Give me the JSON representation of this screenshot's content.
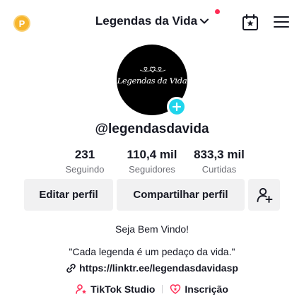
{
  "header": {
    "coin_letter": "P",
    "title": "Legendas da Vida"
  },
  "avatar": {
    "text": "Legendas da Vida"
  },
  "profile": {
    "username": "@legendasdavida"
  },
  "stats": [
    {
      "value": "231",
      "label": "Seguindo"
    },
    {
      "value": "110,4 mil",
      "label": "Seguidores"
    },
    {
      "value": "833,3 mil",
      "label": "Curtidas"
    }
  ],
  "actions": {
    "edit_label": "Editar perfil",
    "share_label": "Compartilhar perfil"
  },
  "bio": {
    "welcome": "Seja Bem Vindo!",
    "quote": "\"Cada legenda é um pedaço da vida.\"",
    "link": "https://linktr.ee/legendasdavidasp"
  },
  "extras": {
    "studio_label": "TikTok Studio",
    "subscription_label": "Inscrição"
  },
  "colors": {
    "accent_red": "#FE2C55",
    "accent_cyan": "#20D5EC",
    "coin_gold": "#F7B52C",
    "button_bg": "#F1F1F2"
  },
  "icons": [
    "coin-icon",
    "chevron-down-icon",
    "calendar-star-icon",
    "menu-icon",
    "plus-icon",
    "add-friend-icon",
    "link-icon",
    "studio-icon",
    "subscription-icon"
  ]
}
